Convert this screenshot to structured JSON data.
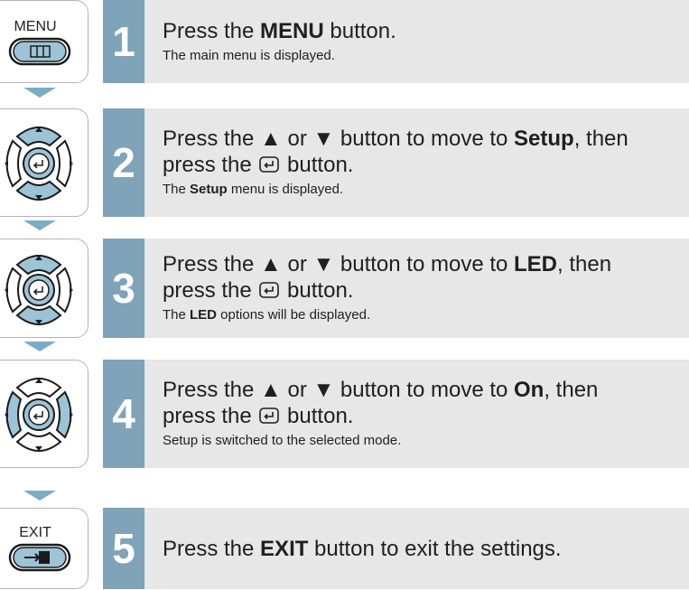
{
  "steps": [
    {
      "number": "1",
      "icon": "menu-button-icon",
      "button_label": "MENU",
      "main": {
        "t1": "Press the ",
        "b1": "MENU",
        "t2": " button."
      },
      "sub": {
        "t1": "The main menu is displayed."
      }
    },
    {
      "number": "2",
      "icon": "dpad-up-down-icon",
      "main": {
        "t1": "Press the ▲ or ▼ button to move to ",
        "b1": "Setup",
        "t2": ", then",
        "line2a": "press the ",
        "line2b": " button."
      },
      "sub": {
        "t1": "The ",
        "b1": "Setup",
        "t2": " menu is displayed."
      }
    },
    {
      "number": "3",
      "icon": "dpad-all-directions-icon",
      "main": {
        "t1": "Press the ▲ or ▼ button to move to ",
        "b1": "LED",
        "t2": ", then",
        "line2a": "press the ",
        "line2b": " button."
      },
      "sub": {
        "t1": "The ",
        "b1": "LED",
        "t2": " options will be displayed."
      }
    },
    {
      "number": "4",
      "icon": "dpad-left-right-icon",
      "main": {
        "t1": "Press the ▲ or ▼ button to move to ",
        "b1": "On",
        "t2": ", then",
        "line2a": "press the ",
        "line2b": " button."
      },
      "sub": {
        "t1": "Setup is switched to the selected mode."
      }
    },
    {
      "number": "5",
      "icon": "exit-button-icon",
      "button_label": "EXIT",
      "main": {
        "t1": "Press the ",
        "b1": "EXIT",
        "t2": " button to exit the settings."
      }
    }
  ],
  "colors": {
    "accent": "#7fa3b8",
    "arrow": "#7cacc4",
    "panel": "#e7e7e7",
    "dpad_highlight": "#9cc3d6"
  }
}
